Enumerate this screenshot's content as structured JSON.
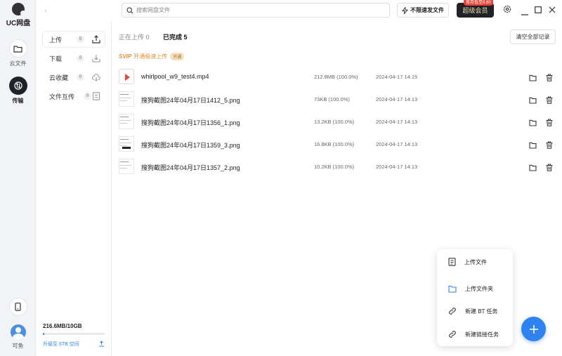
{
  "app": {
    "logo_text": "UC网盘"
  },
  "rail": {
    "items": [
      {
        "label": "云文件",
        "icon": "folder-icon",
        "active": false
      },
      {
        "label": "传输",
        "icon": "transfer-icon",
        "active": true
      }
    ],
    "bottom": {
      "phone_icon": "phone-icon",
      "user_label": "可鱼"
    }
  },
  "titlebar": {
    "search_placeholder": "搜索网盘文件",
    "speed_label": "不限速发文件",
    "vip_label": "超级会员",
    "vip_badge": "首月低至8.80",
    "window_controls": [
      "settings-icon",
      "minimize-icon",
      "maximize-icon",
      "close-icon"
    ]
  },
  "subnav": {
    "items": [
      {
        "label": "上传",
        "count": "5",
        "icon": "upload-icon",
        "active": true
      },
      {
        "label": "下载",
        "count": "0",
        "icon": "download-icon",
        "active": false
      },
      {
        "label": "云收藏",
        "count": "0",
        "icon": "cloud-collect-icon",
        "active": false
      },
      {
        "label": "文件互传",
        "count": "0",
        "icon": "file-transfer-icon",
        "active": false
      }
    ],
    "storage": {
      "used_text": "216.6MB/10GB",
      "used_fraction": 0.021,
      "upgrade_text": "升级至 6TB 空间"
    }
  },
  "main": {
    "tabs": [
      {
        "label": "正在上传 0",
        "active": false
      },
      {
        "label": "已完成 5",
        "active": true
      }
    ],
    "clear_label": "清空全部记录",
    "svip": {
      "tag": "SVIP",
      "text": "开通极速上传",
      "open": "开通"
    },
    "files": [
      {
        "name": "whirlpool_w9_test4.mp4",
        "size": "212.8MB (100.0%)",
        "date": "2024-04-17 14:15",
        "type": "video"
      },
      {
        "name": "搜狗截图24年04月17日1412_5.png",
        "size": "73KB (100.0%)",
        "date": "2024-04-17 14:13",
        "type": "image"
      },
      {
        "name": "搜狗截图24年04月17日1356_1.png",
        "size": "13.2KB (100.0%)",
        "date": "2024-04-17 14:13",
        "type": "image"
      },
      {
        "name": "搜狗截图24年04月17日1359_3.png",
        "size": "16.8KB (100.0%)",
        "date": "2024-04-17 14:13",
        "type": "image"
      },
      {
        "name": "搜狗截图24年04月17日1357_2.png",
        "size": "10.2KB (100.0%)",
        "date": "2024-04-17 14:13",
        "type": "image"
      }
    ]
  },
  "popup": {
    "items": [
      {
        "label": "上传文件",
        "icon": "upload-file-icon"
      },
      {
        "label": "上传文件夹",
        "icon": "upload-folder-icon"
      },
      {
        "label": "新建 BT 任务",
        "icon": "bt-task-icon"
      },
      {
        "label": "新建链接任务",
        "icon": "link-task-icon"
      }
    ]
  },
  "colors": {
    "accent": "#2e83f0",
    "vip_bg": "#1f2329",
    "svip": "#e0913a",
    "danger": "#e8463a"
  }
}
